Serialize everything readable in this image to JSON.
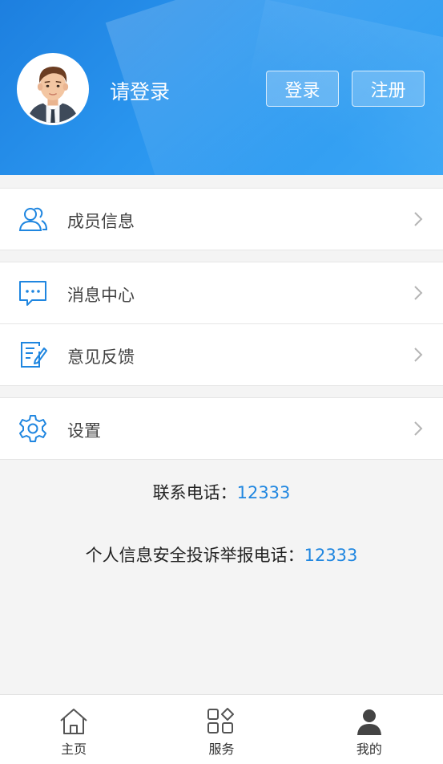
{
  "header": {
    "login_prompt": "请登录",
    "login_button": "登录",
    "register_button": "注册",
    "accent": "#1f86e0"
  },
  "menu": [
    {
      "label": "成员信息",
      "icon": "members-icon"
    },
    {
      "label": "消息中心",
      "icon": "message-icon"
    },
    {
      "label": "意见反馈",
      "icon": "feedback-icon"
    },
    {
      "label": "设置",
      "icon": "settings-icon"
    }
  ],
  "contact": {
    "phone_label": "联系电话：",
    "phone_number": "12333",
    "report_label": "个人信息安全投诉举报电话：",
    "report_number": "12333"
  },
  "tabs": [
    {
      "label": "主页",
      "icon": "home-icon"
    },
    {
      "label": "服务",
      "icon": "services-icon"
    },
    {
      "label": "我的",
      "icon": "profile-icon",
      "active": true
    }
  ]
}
